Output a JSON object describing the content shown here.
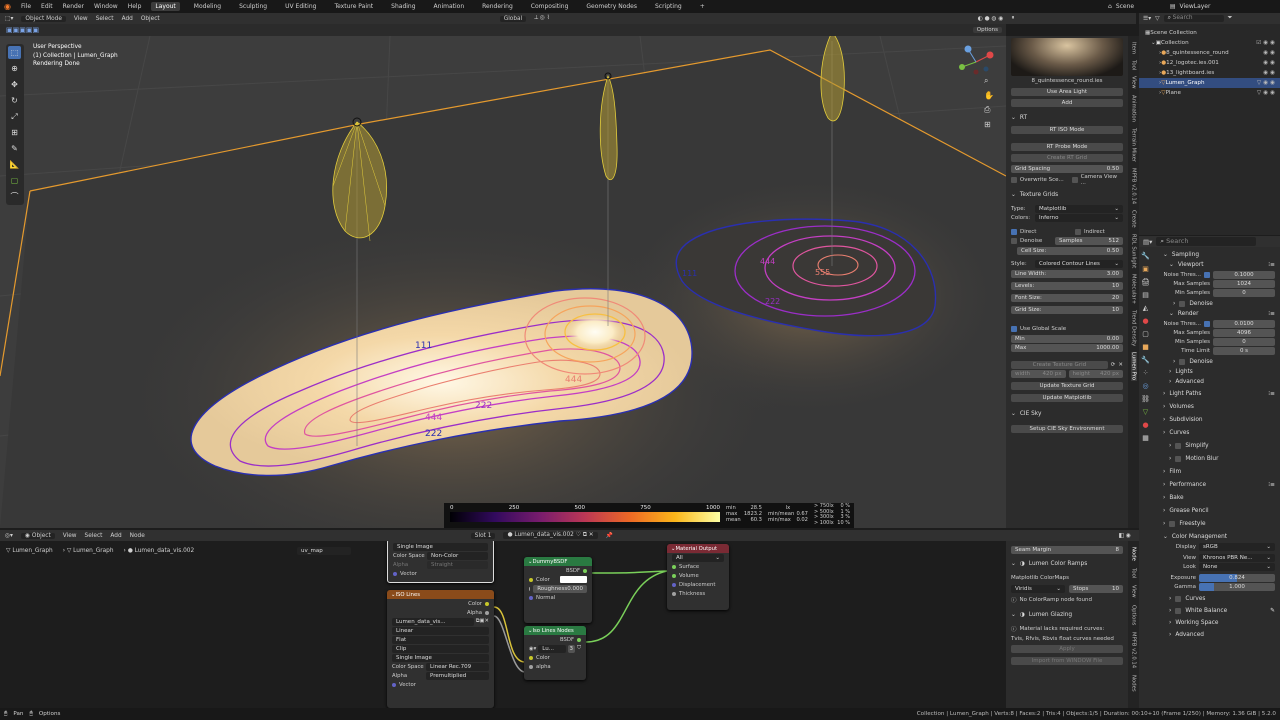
{
  "menubar": {
    "items": [
      "File",
      "Edit",
      "Render",
      "Window",
      "Help"
    ],
    "workspaces": [
      "Layout",
      "Modeling",
      "Sculpting",
      "UV Editing",
      "Texture Paint",
      "Shading",
      "Animation",
      "Rendering",
      "Compositing",
      "Geometry Nodes",
      "Scripting",
      "+"
    ],
    "scene": "Scene",
    "viewlayer": "ViewLayer"
  },
  "viewport": {
    "mode": "Object Mode",
    "menus": [
      "View",
      "Select",
      "Add",
      "Object"
    ],
    "transform": "Global",
    "options": "Options",
    "overlay_line1": "User Perspective",
    "overlay_line2": "(1) Collection | Lumen_Graph",
    "overlay_line3": "Rendering Done"
  },
  "contours": {
    "big": [
      "111",
      "222",
      "444",
      "555",
      "222",
      "444",
      "222"
    ],
    "small": [
      "111",
      "222",
      "444",
      "555"
    ]
  },
  "colorbar": {
    "ticks": [
      "0",
      "250",
      "500",
      "750",
      "1000"
    ],
    "stats_left": [
      [
        "min",
        "28.5"
      ],
      [
        "max",
        "1823.2"
      ],
      [
        "mean",
        "60.3"
      ]
    ],
    "stats_mid": [
      [
        "lx",
        ""
      ],
      [
        "min/mean",
        "0.67"
      ],
      [
        "min/max",
        "0.02"
      ]
    ],
    "stats_right": [
      [
        "> 750lx",
        "0 %"
      ],
      [
        "> 500lx",
        "1 %"
      ],
      [
        "> 300lx",
        "3 %"
      ],
      [
        "> 100lx",
        "10 %"
      ]
    ]
  },
  "npanel": {
    "light_name": "8_quintessence_round.ies",
    "use_area_light": "Use Area Light",
    "add": "Add",
    "rt": "RT",
    "rt_iso": "RT ISO Mode",
    "rt_probe": "RT Probe Mode",
    "create_rt_grid": "Create RT Grid",
    "grid_spacing": "Grid Spacing",
    "grid_spacing_val": "0.50",
    "overwrite": "Overwrite Sce...",
    "camera_view": "Camera View ...",
    "texture_grids": "Texture Grids",
    "type_label": "Type:",
    "type_val": "Matplotlib",
    "colors_label": "Colors:",
    "colors_val": "Inferno",
    "direct": "Direct",
    "indirect": "Indirect",
    "denoise": "Denoise",
    "samples": "Samples",
    "samples_val": "512",
    "cell_size": "Cell Size:",
    "cell_size_val": "0.50",
    "style_label": "Style:",
    "style_val": "Colored Contour Lines",
    "line_width": "Line Width:",
    "line_width_val": "3.00",
    "levels": "Levels:",
    "levels_val": "10",
    "font_size": "Font Size:",
    "font_size_val": "20",
    "grid_size": "Grid Size:",
    "grid_size_val": "10",
    "use_global_scale": "Use Global Scale",
    "min": "Min",
    "min_val": "0.00",
    "max": "Max",
    "max_val": "1000.00",
    "create_texture_grid": "Create Texture Grid",
    "width": "width",
    "width_val": "420 px",
    "height": "height",
    "height_val": "420 px",
    "update_texture_grid": "Update Texture Grid",
    "update_matplotlib": "Update Matplotlib",
    "cie_sky": "CIE Sky",
    "setup_cie": "Setup CIE Sky Environment",
    "tabs": [
      "Item",
      "Tool",
      "View",
      "Animation",
      "Terrain Mixer",
      "MPFB v2.0.14",
      "Create",
      "RDL Sunlight",
      "Molecular+",
      "Trend Density",
      "Lumen Pro"
    ]
  },
  "node_editor": {
    "type": "Object",
    "menus": [
      "View",
      "Select",
      "Add",
      "Node"
    ],
    "breadcrumb": [
      "Lumen_Graph",
      "Lumen_Graph",
      "Lumen_data_vis.002"
    ],
    "slot": "Slot 1",
    "material": "Lumen_data_vis.002",
    "uvmap": "uv_map",
    "image_node_top": {
      "single_image": "Single Image",
      "color_space": "Color Space",
      "color_space_val": "Non-Color",
      "alpha": "Alpha",
      "alpha_val": "Straight",
      "vector": "Vector"
    },
    "iso_lines": {
      "title": "ISO Lines",
      "color": "Color",
      "alpha": "Alpha",
      "image": "Lumen_data_vis...",
      "linear": "Linear",
      "flat": "Flat",
      "clip": "Clip",
      "single_image": "Single Image",
      "color_space": "Color Space",
      "color_space_val": "Linear Rec.709",
      "alpha_label": "Alpha",
      "alpha_val": "Premultiplied",
      "vector": "Vector"
    },
    "dummy": {
      "title": "DummyBSDF",
      "bsdf": "BSDF",
      "color": "Color",
      "roughness": "Roughness",
      "roughness_val": "0.000",
      "normal": "Normal"
    },
    "iso_nodes": {
      "title": "Iso Lines Nodes",
      "bsdf": "BSDF",
      "lu": "Lu...",
      "users": "3",
      "color": "Color",
      "alpha": "alpha"
    },
    "output": {
      "title": "Material Output",
      "target": "All",
      "surface": "Surface",
      "volume": "Volume",
      "displacement": "Displacement",
      "thickness": "Thickness"
    },
    "side": {
      "seam_margin": "Seam Margin",
      "seam_val": "8",
      "ramps": "Lumen Color Ramps",
      "mpl": "Matplotlib ColorMaps",
      "viridis": "Viridis",
      "stops": "Stops",
      "stops_val": "10",
      "no_ramp": "No ColorRamp node found",
      "glazing": "Lumen Glazing",
      "lacks": "Material lacks required curves:",
      "needs": "Tvis, Rfvis, Rbvis float curves needed",
      "apply": "Apply",
      "import": "Import from WINDOW File",
      "tabs": [
        "Node",
        "Tool",
        "View",
        "Options",
        "MPFB v2.0.14",
        "Nodes"
      ]
    }
  },
  "outliner": {
    "title": "Scene Collection",
    "search": "Search",
    "items": [
      {
        "label": "Collection",
        "depth": 0
      },
      {
        "label": "8_quintessence_round",
        "depth": 1
      },
      {
        "label": "12_logotec.ies.001",
        "depth": 1
      },
      {
        "label": "13_lightboard.ies",
        "depth": 1
      },
      {
        "label": "Lumen_Graph",
        "depth": 1
      },
      {
        "label": "Plane",
        "depth": 1
      }
    ]
  },
  "properties": {
    "search": "Search",
    "sampling": "Sampling",
    "viewport": "Viewport",
    "noise_thresh": "Noise Thres...",
    "vp_noise": "0.1000",
    "max_samples": "Max Samples",
    "vp_max": "1024",
    "min_samples": "Min Samples",
    "vp_min": "0",
    "denoise": "Denoise",
    "render": "Render",
    "r_noise": "0.0100",
    "r_max": "4096",
    "r_min": "0",
    "time_limit": "Time Limit",
    "time_val": "0 s",
    "lights": "Lights",
    "advanced": "Advanced",
    "light_paths": "Light Paths",
    "volumes": "Volumes",
    "subdivision": "Subdivision",
    "curves": "Curves",
    "simplify": "Simplify",
    "motion_blur": "Motion Blur",
    "film": "Film",
    "performance": "Performance",
    "bake": "Bake",
    "grease_pencil": "Grease Pencil",
    "freestyle": "Freestyle",
    "color_mgmt": "Color Management",
    "display": "Display",
    "display_val": "sRGB",
    "view": "View",
    "view_val": "Khronos PBR Ne...",
    "look": "Look",
    "look_val": "None",
    "exposure": "Exposure",
    "exposure_val": "0.824",
    "gamma": "Gamma",
    "gamma_val": "1.000",
    "curves2": "Curves",
    "white_balance": "White Balance",
    "working_space": "Working Space",
    "advanced2": "Advanced"
  },
  "statusbar": {
    "left": [
      "Pan",
      "Options"
    ],
    "right": "Collection | Lumen_Graph | Verts:8 | Faces:2 | Tris:4 | Objects:1/5 | Duration: 00:10+10 (Frame 1/250) | Memory: 1.36 GiB | 5.2.0"
  }
}
